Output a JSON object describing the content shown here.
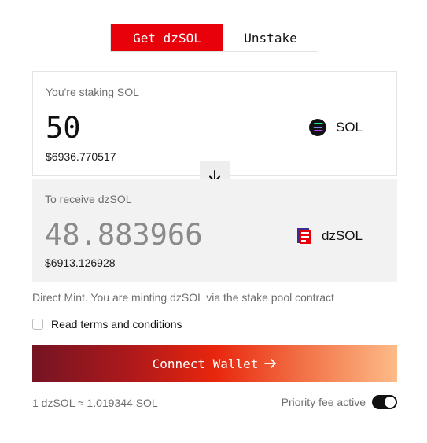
{
  "tabs": [
    {
      "label": "Get dzSOL",
      "active": true
    },
    {
      "label": "Unstake",
      "active": false
    }
  ],
  "stake": {
    "label": "You're staking SOL",
    "amount": "50",
    "usd": "$6936.770517",
    "token": "SOL"
  },
  "receive": {
    "label": "To receive dzSOL",
    "amount": "48.883966",
    "usd": "$6913.126928",
    "token": "dzSOL"
  },
  "info_text": "Direct Mint. You are minting dzSOL via the stake pool contract",
  "terms_label": "Read terms and conditions",
  "terms_checked": false,
  "connect_label": "Connect Wallet",
  "rate_text": "1 dzSOL ≈ 1.019344 SOL",
  "priority_fee_label": "Priority fee active",
  "priority_fee_on": true,
  "icons": {
    "sol": "solana-logo-icon",
    "dzsol": "dzsol-logo-icon",
    "swap": "arrow-down-icon",
    "connect": "arrow-right-icon"
  },
  "colors": {
    "accent": "#e8000b",
    "gradient": [
      "#741423",
      "#b0191a",
      "#e8260d",
      "#f27448",
      "#fdbb88"
    ],
    "muted_text": "#6e6e6e",
    "receive_bg": "#f2f2f2",
    "toggle_on": "#111111"
  }
}
